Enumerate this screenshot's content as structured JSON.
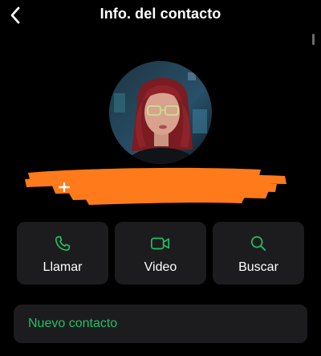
{
  "nav": {
    "title": "Info. del contacto",
    "back_icon": "chevron-left-icon"
  },
  "profile": {
    "avatar": "profile-photo",
    "name_redacted": true
  },
  "actions": [
    {
      "label": "Llamar",
      "icon": "phone-icon"
    },
    {
      "label": "Video",
      "icon": "video-camera-icon"
    },
    {
      "label": "Buscar",
      "icon": "search-icon"
    }
  ],
  "new_contact": {
    "label": "Nuevo contacto"
  },
  "colors": {
    "background": "#000000",
    "card": "#1c1c1e",
    "accent": "#21c063",
    "redaction": "#ff7a1a"
  }
}
